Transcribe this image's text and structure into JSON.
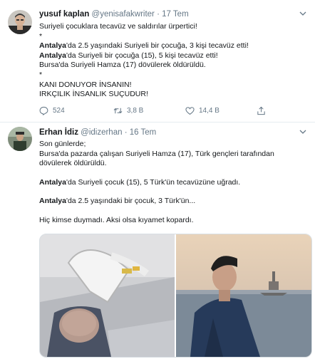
{
  "tweet1": {
    "author": {
      "name": "yusuf kaplan",
      "handle": "@yenisafakwriter",
      "time": "17 Tem"
    },
    "lines": [
      {
        "parts": [
          {
            "t": "Suriyeli çocuklara tecavüz ve saldırılar ürpertici!"
          }
        ]
      },
      {
        "parts": [
          {
            "t": "*"
          }
        ]
      },
      {
        "parts": [
          {
            "t": "Antalya",
            "b": true
          },
          {
            "t": "'da 2.5 yaşındaki Suriyeli bir çocuğa, 3 kişi tecavüz etti!"
          }
        ]
      },
      {
        "parts": [
          {
            "t": "Antalya",
            "b": true
          },
          {
            "t": "'da Suriyeli bir çocuğa (15), 5 kişi tecavüz etti!"
          }
        ]
      },
      {
        "parts": [
          {
            "t": "Bursa'da Suriyeli Hamza (17) dövülerek öldürüldü."
          }
        ]
      },
      {
        "parts": [
          {
            "t": "*"
          }
        ]
      },
      {
        "parts": [
          {
            "t": "KANI DONUYOR İNSANIN!"
          }
        ]
      },
      {
        "parts": [
          {
            "t": "IRKÇILIK İNSANLIK SUÇUDUR!"
          }
        ]
      }
    ],
    "actions": {
      "replies": "524",
      "retweets": "3,8 B",
      "likes": "14,4 B"
    }
  },
  "tweet2": {
    "author": {
      "name": "Erhan İdiz",
      "handle": "@idizerhan",
      "time": "16 Tem"
    },
    "lines": [
      {
        "parts": [
          {
            "t": "Son günlerde;"
          }
        ]
      },
      {
        "parts": [
          {
            "t": "Bursa'da pazarda çalışan Suriyeli Hamza (17), Türk gençleri tarafından"
          }
        ]
      },
      {
        "parts": [
          {
            "t": "dövülerek öldürüldü."
          }
        ]
      },
      {
        "gap": true
      },
      {
        "parts": [
          {
            "t": "Antalya",
            "b": true
          },
          {
            "t": "'da Suriyeli çocuk (15), 5 Türk'ün tecavüzüne uğradı."
          }
        ]
      },
      {
        "gap": true
      },
      {
        "parts": [
          {
            "t": "Antalya",
            "b": true
          },
          {
            "t": "'da 2.5 yaşındaki bir çocuk, 3 Türk'ün..."
          }
        ]
      },
      {
        "gap": true
      },
      {
        "parts": [
          {
            "t": "Hiç kimse duymadı. Aksi olsa kıyamet kopardı."
          }
        ]
      }
    ]
  },
  "icons": {
    "reply": "reply-icon",
    "retweet": "retweet-icon",
    "like": "heart-icon",
    "share": "share-icon",
    "more": "chevron-down-icon"
  },
  "colors": {
    "text": "#14171a",
    "muted": "#657786",
    "divider": "#e6ecf0"
  }
}
